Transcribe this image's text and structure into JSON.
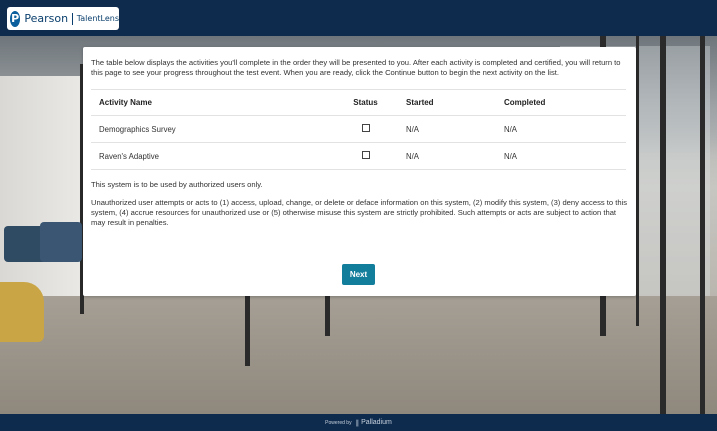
{
  "header": {
    "logo_letter": "P",
    "brand": "Pearson",
    "product": "TalentLens",
    "background_color": "#0e2a4d"
  },
  "main": {
    "intro": "The table below displays the activities you'll complete in the order they will be presented to you. After each activity is completed and certified, you will return to this page to see your progress throughout the test event. When you are ready, click the Continue button to begin the next activity on the list.",
    "table": {
      "columns": [
        "Activity Name",
        "Status",
        "Started",
        "Completed"
      ],
      "rows": [
        {
          "activity": "Demographics Survey",
          "status_checked": false,
          "started": "N/A",
          "completed": "N/A"
        },
        {
          "activity": "Raven's Adaptive",
          "status_checked": false,
          "started": "N/A",
          "completed": "N/A"
        }
      ]
    },
    "notice": "This system is to be used by authorized users only.",
    "legal": "Unauthorized user attempts or acts to (1) access, upload, change, or delete or deface information on this system, (2) modify this system, (3) deny access to this system, (4) accrue resources for unauthorized use or (5) otherwise misuse this system are strictly prohibited. Such attempts or acts are subject to action that may result in penalties.",
    "next_label": "Next",
    "button_color": "#137d9c"
  },
  "footer": {
    "powered_by": "Powered by",
    "brand": "Palladium",
    "icon": "palladium-logo-icon"
  }
}
